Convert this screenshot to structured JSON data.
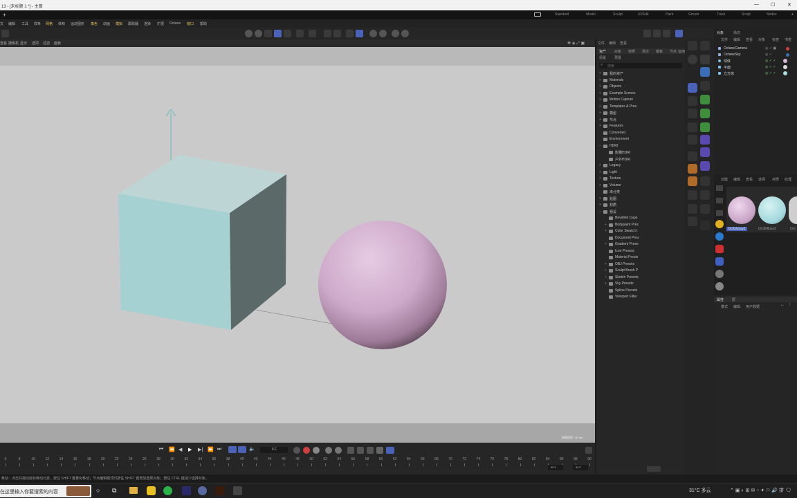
{
  "window": {
    "title": "13 - [未标题 1 *] - 主窗",
    "controls": [
      "—",
      "☐",
      "✕"
    ]
  },
  "tabs": {
    "plus": "+"
  },
  "layouts": {
    "items": [
      "Standard",
      "Model",
      "Sculpt",
      "UVEdit",
      "Paint",
      "Groom",
      "Track",
      "Script",
      "Nodes"
    ],
    "plus": "+"
  },
  "menubar": {
    "items": [
      "文",
      "编辑",
      "工具",
      "样条",
      "网格",
      "体积",
      "运动图形",
      "角色",
      "动画",
      "模拟",
      "跟踪器",
      "渲染",
      "扩展",
      "Octane",
      "窗口",
      "帮助"
    ]
  },
  "viewport": {
    "menu": [
      "查看",
      "摄像机",
      "显示",
      "选项",
      "过滤",
      "面板"
    ],
    "camera_label": "OctaneCamera",
    "grid_info": "网格间距 : 50 cm"
  },
  "browser": {
    "tabs": [
      "资产",
      "对象",
      "材质",
      "场次",
      "模板",
      "节点",
      "运用"
    ],
    "sub_tabs": [
      "场景",
      "预置"
    ],
    "search_placeholder": "搜索",
    "items": [
      {
        "label": "我的资产",
        "indent": 0,
        "exp": "+"
      },
      {
        "label": "Materials",
        "indent": 0,
        "exp": "+"
      },
      {
        "label": "Objects",
        "indent": 0,
        "exp": "+"
      },
      {
        "label": "Example Scenes",
        "indent": 0,
        "exp": "+"
      },
      {
        "label": "Motion Capture",
        "indent": 0,
        "exp": "+"
      },
      {
        "label": "Templates & Pres",
        "indent": 0,
        "exp": "+"
      },
      {
        "label": "模型",
        "indent": 0,
        "exp": "+"
      },
      {
        "label": "节点",
        "indent": 0,
        "exp": "+"
      },
      {
        "label": "Features",
        "indent": 0,
        "exp": "+"
      },
      {
        "label": "Converted",
        "indent": 0,
        "exp": ""
      },
      {
        "label": "Environment",
        "indent": 0,
        "exp": ""
      },
      {
        "label": "HDRI",
        "indent": 0,
        "exp": "−"
      },
      {
        "label": "影棚HDRI",
        "indent": 1,
        "exp": ""
      },
      {
        "label": "户外HDRI",
        "indent": 1,
        "exp": ""
      },
      {
        "label": "Legacy",
        "indent": 0,
        "exp": "+"
      },
      {
        "label": "Light",
        "indent": 0,
        "exp": "+"
      },
      {
        "label": "Texture",
        "indent": 0,
        "exp": "+"
      },
      {
        "label": "Volume",
        "indent": 0,
        "exp": "+"
      },
      {
        "label": "未分类",
        "indent": 0,
        "exp": ""
      },
      {
        "label": "贴图",
        "indent": 0,
        "exp": "+"
      },
      {
        "label": "材质",
        "indent": 0,
        "exp": "+"
      },
      {
        "label": "预设",
        "indent": 0,
        "exp": "−"
      },
      {
        "label": "Bevelled Caps",
        "indent": 1,
        "exp": ""
      },
      {
        "label": "Bodypaint Pres",
        "indent": 1,
        "exp": "+"
      },
      {
        "label": "Color Swatch I",
        "indent": 1,
        "exp": "+"
      },
      {
        "label": "Document Pres",
        "indent": 1,
        "exp": ""
      },
      {
        "label": "Gradient Prese",
        "indent": 1,
        "exp": "+"
      },
      {
        "label": "Icon Presets",
        "indent": 1,
        "exp": ""
      },
      {
        "label": "Material Presis",
        "indent": 1,
        "exp": ""
      },
      {
        "label": "OBJ Presets",
        "indent": 1,
        "exp": "+"
      },
      {
        "label": "Sculpt Brush P",
        "indent": 1,
        "exp": "+"
      },
      {
        "label": "Sketch Presets",
        "indent": 1,
        "exp": "+"
      },
      {
        "label": "Sky Presets",
        "indent": 1,
        "exp": "+"
      },
      {
        "label": "Spline Presets",
        "indent": 1,
        "exp": ""
      },
      {
        "label": "Viewport Filter",
        "indent": 1,
        "exp": ""
      }
    ]
  },
  "objects": {
    "tabs": [
      "对象",
      "场次"
    ],
    "menu": [
      "文件",
      "编辑",
      "查看",
      "对象",
      "标签",
      "书签"
    ],
    "rows": [
      {
        "label": "OctaneCamera",
        "color": "#8fb0e0"
      },
      {
        "label": "OctaneSky",
        "color": "#8fb0e0"
      },
      {
        "label": "球体",
        "color": "#7fc1e8"
      },
      {
        "label": "平面",
        "color": "#7fc1e8"
      },
      {
        "label": "立方体",
        "color": "#7fc1e8"
      }
    ]
  },
  "materials": {
    "menu": [
      "创建",
      "编辑",
      "查看",
      "选择",
      "材质",
      "纹理"
    ],
    "swatches": [
      {
        "label": "OctGlossy1",
        "color": "#d7b8d8"
      },
      {
        "label": "OctDiffuse2",
        "color": "#a8dde0"
      },
      {
        "label": "Oct",
        "color": "#cfcfcf"
      }
    ]
  },
  "attributes": {
    "tabs": [
      "属性",
      "层"
    ],
    "menu": [
      "模式",
      "编辑",
      "用户数据"
    ]
  },
  "timeline": {
    "frame_field": "0 F",
    "start_field": "0 F",
    "end_field": "90 F",
    "end_field2": "90 F",
    "ruler": [
      "6",
      "8",
      "10",
      "12",
      "14",
      "16",
      "18",
      "20",
      "22",
      "24",
      "26",
      "28",
      "30",
      "32",
      "34",
      "36",
      "38",
      "40",
      "42",
      "44",
      "46",
      "48",
      "50",
      "52",
      "54",
      "56",
      "58",
      "60",
      "62",
      "64",
      "66",
      "68",
      "70",
      "72",
      "74",
      "76",
      "78",
      "80",
      "82",
      "84",
      "86",
      "88",
      "90"
    ]
  },
  "status": {
    "text": "移动：点击并拖动鼠标移动元素。按住 SHIFT 键量化移动；节点编辑模式时按住 SHIFT 键增加选择对象；按住 CTRL 键减少选择对象。"
  },
  "taskbar": {
    "search_text": "在这里输入你要搜索的内容",
    "weather": "31°C 多云",
    "time": ""
  }
}
